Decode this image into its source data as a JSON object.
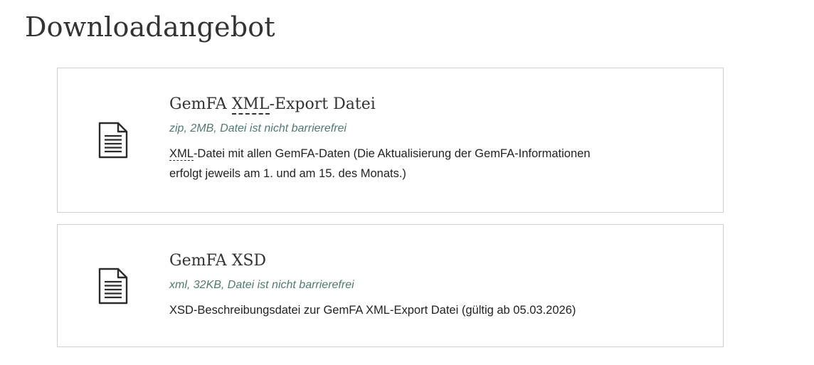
{
  "page": {
    "title": "Downloadangebot"
  },
  "downloads": [
    {
      "title_abbr": "XML",
      "title_prefix": "GemFA ",
      "title_suffix": "-Export Datei",
      "meta": "zip, 2MB, Datei ist nicht barrierefrei",
      "desc_abbr": "XML",
      "desc_line1_rest": "-Datei mit allen GemFA-Daten (Die Aktualisierung der GemFA-Informationen",
      "desc_line2": "erfolgt jeweils am 1. und am 15. des Monats.)",
      "icon": "document-icon"
    },
    {
      "title": "GemFA XSD",
      "meta": "xml, 32KB, Datei ist nicht barrierefrei",
      "desc": "XSD-Beschreibungsdatei zur GemFA XML-Export Datei (gültig ab 05.03.2026)",
      "icon": "document-icon"
    }
  ],
  "colors": {
    "meta_text": "#4f7a70",
    "card_border": "#cfcfcf",
    "title_text": "#333333"
  }
}
